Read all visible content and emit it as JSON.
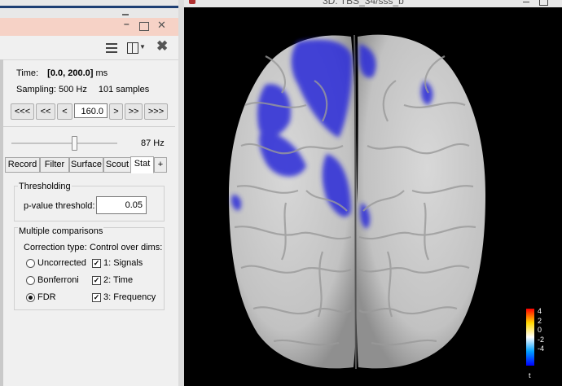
{
  "window_title": "3D: TBS_34/sss_b",
  "toolbar": {
    "list_icon": "list-icon",
    "layout_icon": "layout-icon",
    "close_icon": "close-icon"
  },
  "time": {
    "label": "Time:",
    "value": "[0.0, 200.0]",
    "unit": "ms"
  },
  "sampling": {
    "label": "Sampling: 500 Hz",
    "samples": "101 samples"
  },
  "nav": {
    "buttons": [
      "<<<",
      "<<",
      "<",
      ">",
      ">>",
      ">>>"
    ],
    "current": "160.0"
  },
  "slider": {
    "value_label": "87 Hz"
  },
  "tabs": [
    "Record",
    "Filter",
    "Surface",
    "Scout",
    "Stat",
    "+"
  ],
  "active_tab": "Stat",
  "thresholding": {
    "title": "Thresholding",
    "pvalue_label": "p-value threshold:",
    "pvalue": "0.05"
  },
  "multiple": {
    "title": "Multiple comparisons",
    "correction_label": "Correction type:",
    "control_label": "Control over dims:",
    "options": [
      "Uncorrected",
      "Bonferroni",
      "FDR"
    ],
    "selected": "FDR",
    "dims": [
      "1: Signals",
      "2: Time",
      "3: Frequency"
    ]
  },
  "colorbar": {
    "ticks": [
      "4",
      "2",
      "0",
      "-2",
      "-4"
    ],
    "unit": "t"
  },
  "colors": {
    "significant": "#2a2ad8",
    "brain": "#cfcfcf",
    "background": "#000000"
  }
}
